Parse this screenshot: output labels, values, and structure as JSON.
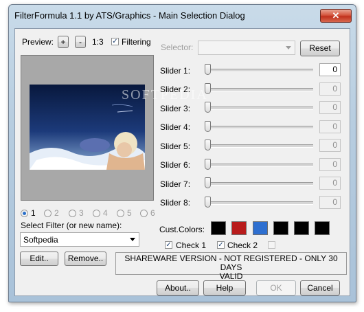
{
  "window": {
    "title": "FilterFormula 1.1 by ATS/Graphics - Main Selection Dialog",
    "close_glyph": "✕"
  },
  "preview": {
    "label": "Preview:",
    "zoom_in_label": "+",
    "zoom_out_label": "-",
    "ratio": "1:3",
    "filtering_label": "Filtering",
    "filtering_checked": true,
    "watermark": "SOFTPEDIA"
  },
  "selector": {
    "label": "Selector:",
    "value": ""
  },
  "reset_label": "Reset",
  "sliders": [
    {
      "label": "Slider 1:",
      "value": "0",
      "enabled": true
    },
    {
      "label": "Slider 2:",
      "value": "0",
      "enabled": false
    },
    {
      "label": "Slider 3:",
      "value": "0",
      "enabled": false
    },
    {
      "label": "Slider 4:",
      "value": "0",
      "enabled": false
    },
    {
      "label": "Slider 5:",
      "value": "0",
      "enabled": false
    },
    {
      "label": "Slider 6:",
      "value": "0",
      "enabled": false
    },
    {
      "label": "Slider 7:",
      "value": "0",
      "enabled": false
    },
    {
      "label": "Slider 8:",
      "value": "0",
      "enabled": false
    }
  ],
  "radios": [
    {
      "label": "1",
      "selected": true
    },
    {
      "label": "2",
      "selected": false
    },
    {
      "label": "3",
      "selected": false
    },
    {
      "label": "4",
      "selected": false
    },
    {
      "label": "5",
      "selected": false
    },
    {
      "label": "6",
      "selected": false
    }
  ],
  "filter": {
    "label": "Select Filter (or new name):",
    "value": "Softpedia"
  },
  "edit_label": "Edit..",
  "remove_label": "Remove..",
  "cust_colors": {
    "label": "Cust.Colors:",
    "colors": [
      "#000000",
      "#b81c1c",
      "#2e6fd0",
      "#000000",
      "#000000",
      "#000000"
    ]
  },
  "checks": [
    {
      "label": "Check 1",
      "checked": true
    },
    {
      "label": "Check 2",
      "checked": true
    },
    {
      "label": "",
      "checked": false
    }
  ],
  "notice": {
    "line1": "SHAREWARE VERSION - NOT REGISTERED - ONLY 30 DAYS",
    "line2": "VALID"
  },
  "buttons": {
    "about": "About..",
    "help": "Help",
    "ok": "OK",
    "cancel": "Cancel"
  }
}
